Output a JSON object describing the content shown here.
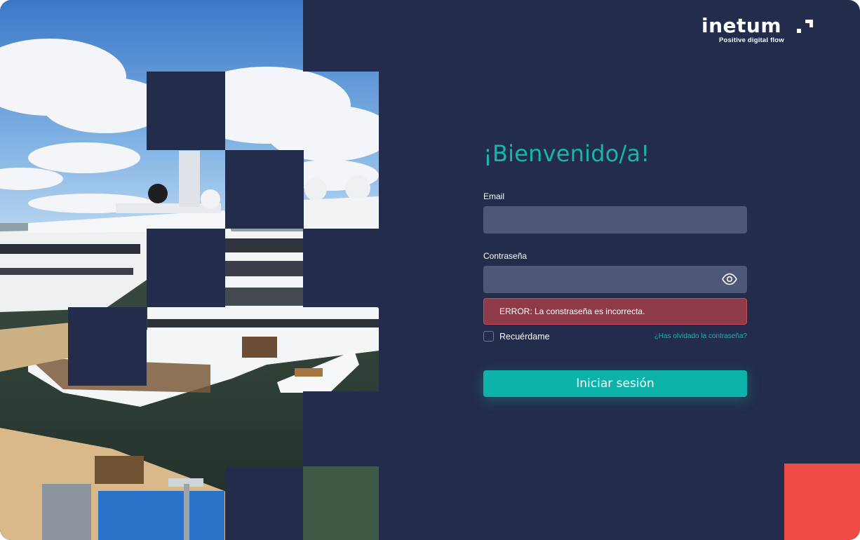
{
  "brand": {
    "name": "inetum",
    "tagline": "Positive digital flow"
  },
  "login": {
    "title": "¡Bienvenido/a!",
    "email_label": "Email",
    "email_value": "",
    "password_label": "Contraseña",
    "password_value": "",
    "error_text": "ERROR: La constraseña es incorrecta.",
    "remember_label": "Recuérdame",
    "remember_checked": false,
    "forgot_link": "¿Has olvidado la contraseña?",
    "submit_label": "Iniciar sesión"
  },
  "icons": {
    "password_toggle": "eye-icon",
    "logo_mark": "corner-bracket-mark"
  },
  "colors": {
    "background": "#232d4b",
    "accent": "#16b5ad",
    "button": "#0db3a9",
    "input": "#4e5778",
    "error": "#8f3a48",
    "corner_block": "#ef4c45"
  }
}
